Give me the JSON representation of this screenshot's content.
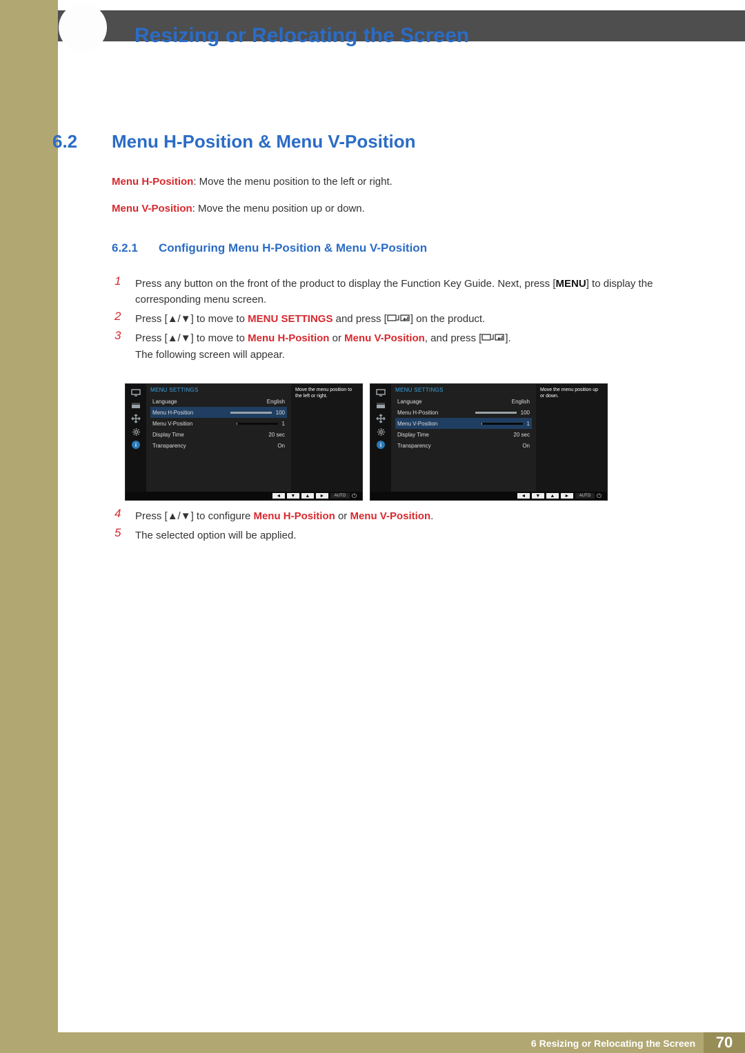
{
  "chapter_title": "Resizing or Relocating the Screen",
  "section": {
    "num": "6.2",
    "title": "Menu H-Position & Menu V-Position"
  },
  "desc": {
    "h_label": "Menu H-Position",
    "h_text": ": Move the menu position to the left or right.",
    "v_label": "Menu V-Position",
    "v_text": ": Move the menu position up or down."
  },
  "subsection": {
    "num": "6.2.1",
    "title": "Configuring Menu H-Position & Menu V-Position"
  },
  "steps": {
    "s1a": "Press any button on the front of the product to display the Function Key Guide. Next, press [",
    "s1_menu": "MENU",
    "s1b": "] to display the corresponding menu screen.",
    "s2a": "Press [",
    "arrows_ud": "▲/▼",
    "s2b": "] to move to ",
    "s2_menu_settings": "MENU SETTINGS",
    "s2c": " and press [",
    "s2d": "] on the product.",
    "s3a": "Press [",
    "s3b": "] to move to ",
    "s3_h": "Menu H-Position",
    "s3_or": " or ",
    "s3_v": "Menu V-Position",
    "s3c": ", and press [",
    "s3d": "].",
    "s3e": "The following screen will appear.",
    "s4a": "Press [",
    "s4b": "] to configure ",
    "s4_h": "Menu H-Position",
    "s4_v": "Menu V-Position",
    "s4c": ".",
    "s5": "The selected option will be applied."
  },
  "osd": {
    "title": "MENU SETTINGS",
    "rows": {
      "language": {
        "label": "Language",
        "value": "English"
      },
      "hpos": {
        "label": "Menu H-Position",
        "value": "100",
        "fill": 100
      },
      "vpos": {
        "label": "Menu V-Position",
        "value": "1",
        "fill": 2
      },
      "dtime": {
        "label": "Display Time",
        "value": "20 sec"
      },
      "trans": {
        "label": "Transparency",
        "value": "On"
      }
    },
    "hint_h": "Move the menu position to the left or right.",
    "hint_v": "Move the menu position up or down.",
    "nav": {
      "left": "◄",
      "down": "▼",
      "up": "▲",
      "right": "►",
      "auto": "AUTO",
      "power": "⏻"
    },
    "icons": [
      "monitor",
      "panel",
      "move",
      "gear",
      "info"
    ]
  },
  "footer": {
    "chapter_num": "6",
    "label": "Resizing or Relocating the Screen",
    "page": "70"
  }
}
